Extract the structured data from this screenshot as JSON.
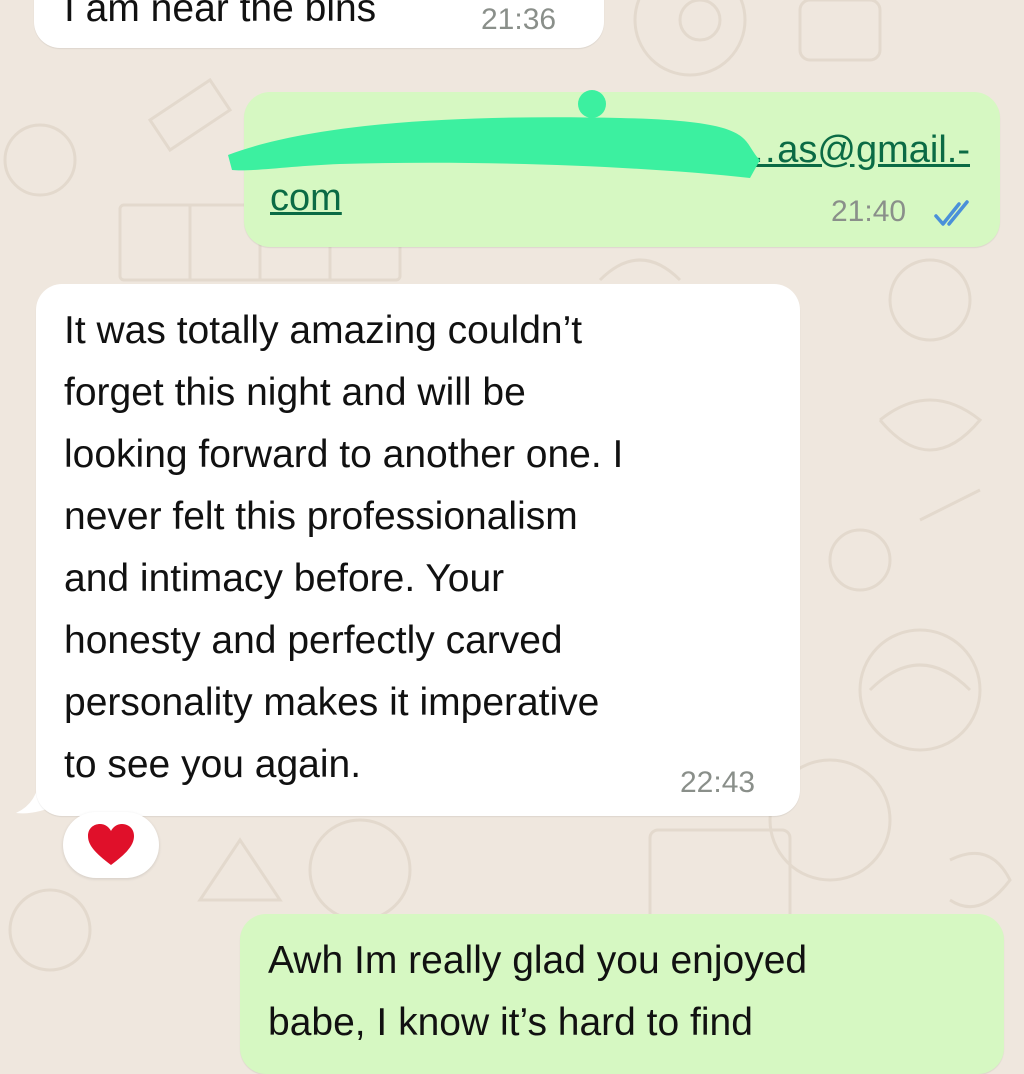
{
  "messages": [
    {
      "id": "m1",
      "direction": "incoming",
      "text": "I am near the bins",
      "time": "21:36"
    },
    {
      "id": "m2",
      "direction": "outgoing",
      "link_line1": "V…as@gmail.-",
      "link_line2": "com",
      "time": "21:40",
      "status": "read"
    },
    {
      "id": "m3",
      "direction": "incoming",
      "lines": [
        "It was totally amazing couldn’t",
        "forget this night and will be",
        "looking forward to another one. I",
        "never felt this  professionalism",
        "and intimacy before. Your",
        "honesty and perfectly carved",
        "personality makes it imperative",
        "to see you again."
      ],
      "time": "22:43",
      "reaction": "❤️"
    },
    {
      "id": "m4",
      "direction": "outgoing",
      "lines": [
        "Awh Im really glad you enjoyed",
        "babe, I know it’s hard to find"
      ]
    }
  ],
  "colors": {
    "wallpaper": "#efe7de",
    "incoming_bubble": "#ffffff",
    "outgoing_bubble": "#d6f8c2",
    "redaction": "#3cf0a0",
    "read_ticks": "#4a90d9",
    "heart": "#e0102a"
  },
  "icons": [
    "double-check-icon",
    "heart-icon"
  ]
}
